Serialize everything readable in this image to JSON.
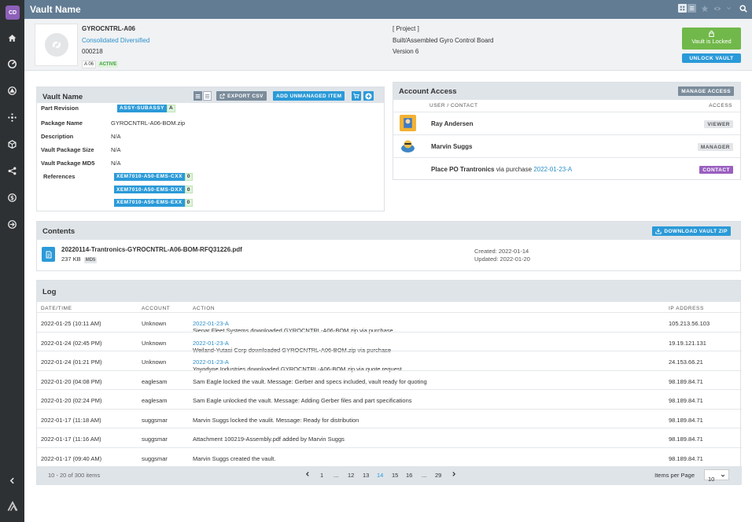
{
  "app": {
    "user_initials": "CD",
    "title": "Vault Name"
  },
  "rail": {
    "items": [
      "home-icon",
      "dashboard-icon",
      "quality-icon",
      "network-icon",
      "box-icon",
      "share-icon",
      "dollar-icon",
      "arrow-circle-icon",
      "collapse-icon",
      "logo-icon"
    ]
  },
  "header": {
    "part_number": "GYROCNTRL-A06",
    "company": "Consolidated Diversified",
    "part_id": "000218",
    "revision": "A 06",
    "status": "ACTIVE",
    "project": "[ Project ]",
    "description": "Built/Assembled Gyro Control Board",
    "version": "Version 6",
    "lock_label": "Vault is Locked",
    "unlock_label": "UNLOCK VAULT"
  },
  "vault": {
    "title": "Vault Name",
    "export_label": "EXPORT CSV",
    "add_label": "ADD UNMANAGED ITEM",
    "fields": {
      "part_revision_label": "Part Revision",
      "part_revision_tag": "ASSY-SUBASSY",
      "part_revision_rev": "A",
      "package_name_label": "Package Name",
      "package_name": "GYROCNTRL-A06-BOM.zip",
      "description_label": "Description",
      "description": "N/A",
      "size_label": "Vault Package Size",
      "size": "N/A",
      "md5_label": "Vault Package MD5",
      "md5": "N/A",
      "references_label": "References"
    },
    "references": [
      {
        "name": "XEM7010-A50-EMS-CXX",
        "count": "0"
      },
      {
        "name": "XEM7010-A50-EMS-DXX",
        "count": "0"
      },
      {
        "name": "XEM7010-A50-EMS-EXX",
        "count": "0"
      }
    ]
  },
  "access": {
    "title": "Account Access",
    "manage_label": "MANAGE ACCESS",
    "col_user": "USER / CONTACT",
    "col_access": "ACCESS",
    "rows": [
      {
        "name": "Ray Andersen",
        "role": "VIEWER"
      },
      {
        "name": "Marvin Suggs",
        "role": "MANAGER"
      },
      {
        "name": "Place PO Trantronics",
        "via": "via purchase",
        "link": "2022-01-23-A",
        "role": "CONTACT"
      }
    ]
  },
  "contents": {
    "title": "Contents",
    "download_label": "DOWNLOAD VAULT ZIP",
    "file_name": "20220114-Trantronics-GYROCNTRL-A06-BOM-RFQ31226.pdf",
    "file_size": "237 KB",
    "file_tag": "MD5",
    "created": "Created: 2022-01-14",
    "updated": "Updated: 2022-01-20"
  },
  "log": {
    "title": "Log",
    "columns": {
      "datetime": "DATE/TIME",
      "account": "ACCOUNT",
      "action": "ACTION",
      "ip": "IP ADDRESS"
    },
    "rows": [
      {
        "datetime": "2022-01-25 (10:11 AM)",
        "account": "Unknown",
        "action": "Sienar Fleet Systems downloaded GYROCNTRL-A06-BOM.zip via purchase ",
        "link": "2022-01-23-A",
        "suffix": ".",
        "ip": "105.213.56.103"
      },
      {
        "datetime": "2022-01-24 (02:45 PM)",
        "account": "Unknown",
        "action": "Weiland-Yutani Corp downloaded GYROCNTRL-A06-BOM.zip via purchase ",
        "link": "2022-01-23-A",
        "suffix": ".",
        "ip": "19.19.121.131"
      },
      {
        "datetime": "2022-01-24 (01:21 PM)",
        "account": "Unknown",
        "action": "Yoyodyne Industries downloaded GYROCNTRL-A06-BOM.zip via quote request ",
        "link": "2022-01-23-A",
        "suffix": ".",
        "ip": "24.153.66.21"
      },
      {
        "datetime": "2022-01-20 (04:08 PM)",
        "account": "eaglesam",
        "action": "Sam Eagle locked the vault. Message: Gerber and specs included, vault ready for quoting",
        "link": "",
        "suffix": "",
        "ip": "98.189.84.71"
      },
      {
        "datetime": "2022-01-20 (02:24 PM)",
        "account": "eaglesam",
        "action": "Sam Eagle unlocked the vault. Message: Adding Gerber files and part specifications",
        "link": "",
        "suffix": "",
        "ip": "98.189.84.71"
      },
      {
        "datetime": "2022-01-17 (11:18 AM)",
        "account": "suggsmar",
        "action": "Marvin Suggs locked the vaulit. Message: Ready for distribution",
        "link": "",
        "suffix": "",
        "ip": "98.189.84.71"
      },
      {
        "datetime": "2022-01-17 (11:16 AM)",
        "account": "suggsmar",
        "action": "Attachment 100219-Assembly.pdf added by Marvin Suggs",
        "link": "",
        "suffix": "",
        "ip": "98.189.84.71"
      },
      {
        "datetime": "2022-01-17 (09:40 AM)",
        "account": "suggsmar",
        "action": "Marvin Suggs created the vault.",
        "link": "",
        "suffix": "",
        "ip": "98.189.84.71"
      }
    ],
    "pager": {
      "summary": "10 - 20 of 300 items",
      "pages": [
        "1",
        "...",
        "12",
        "13",
        "14",
        "15",
        "16",
        "...",
        "29"
      ],
      "current": "14",
      "per_page_label": "Items per Page",
      "per_page": "10"
    }
  },
  "colors": {
    "topbar": "#627c93",
    "accent": "#2b9ad8",
    "locked": "#71b84a",
    "contact": "#9a5fc0",
    "rail": "#2e3134"
  }
}
